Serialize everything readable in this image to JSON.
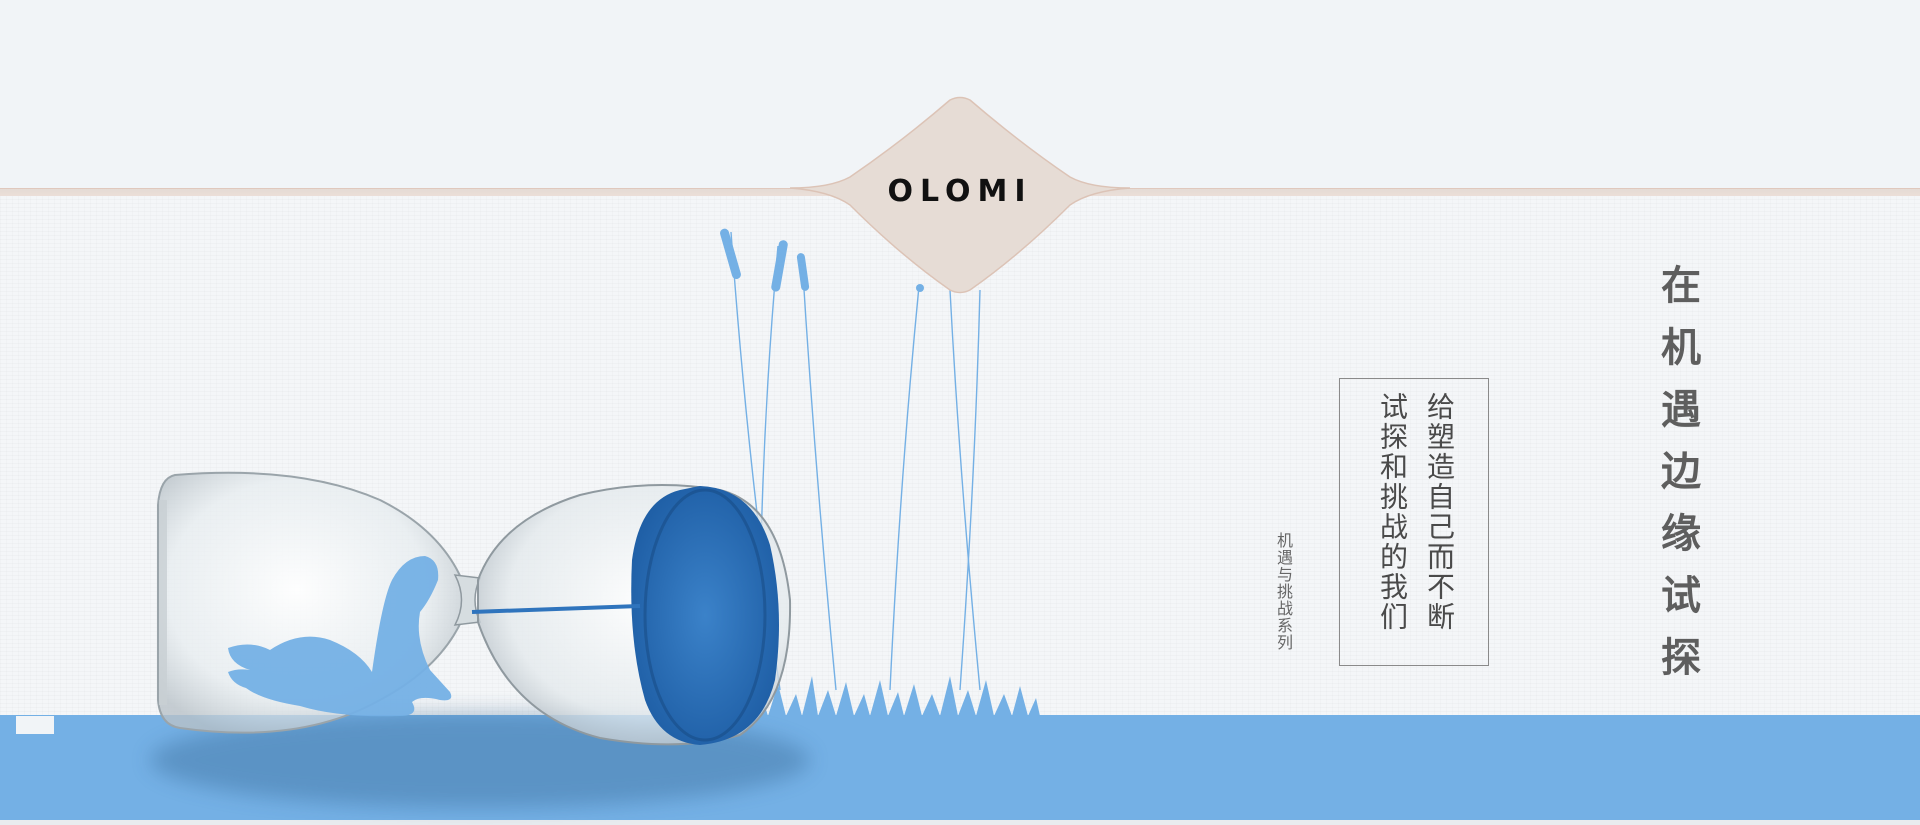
{
  "brand": {
    "logo_text": "OLOMI"
  },
  "copy": {
    "series_label": "机遇与挑战系列",
    "quote_line_1": "给塑造自己而不断",
    "quote_line_2": "试探和挑战的我们",
    "headline": "在机遇边缘试探"
  },
  "colors": {
    "background": "#f1f4f7",
    "accent_blue": "#74b0e5",
    "sand_blue": "#2f74bd",
    "badge_beige": "#e6dcd5",
    "text_gray": "#5e5e5e"
  },
  "icons": {
    "logo_badge": "logo-badge-shape",
    "hourglass": "hourglass-illustration",
    "swan": "swan-silhouette",
    "reeds": "reed-stems",
    "grass": "grass-silhouette"
  }
}
